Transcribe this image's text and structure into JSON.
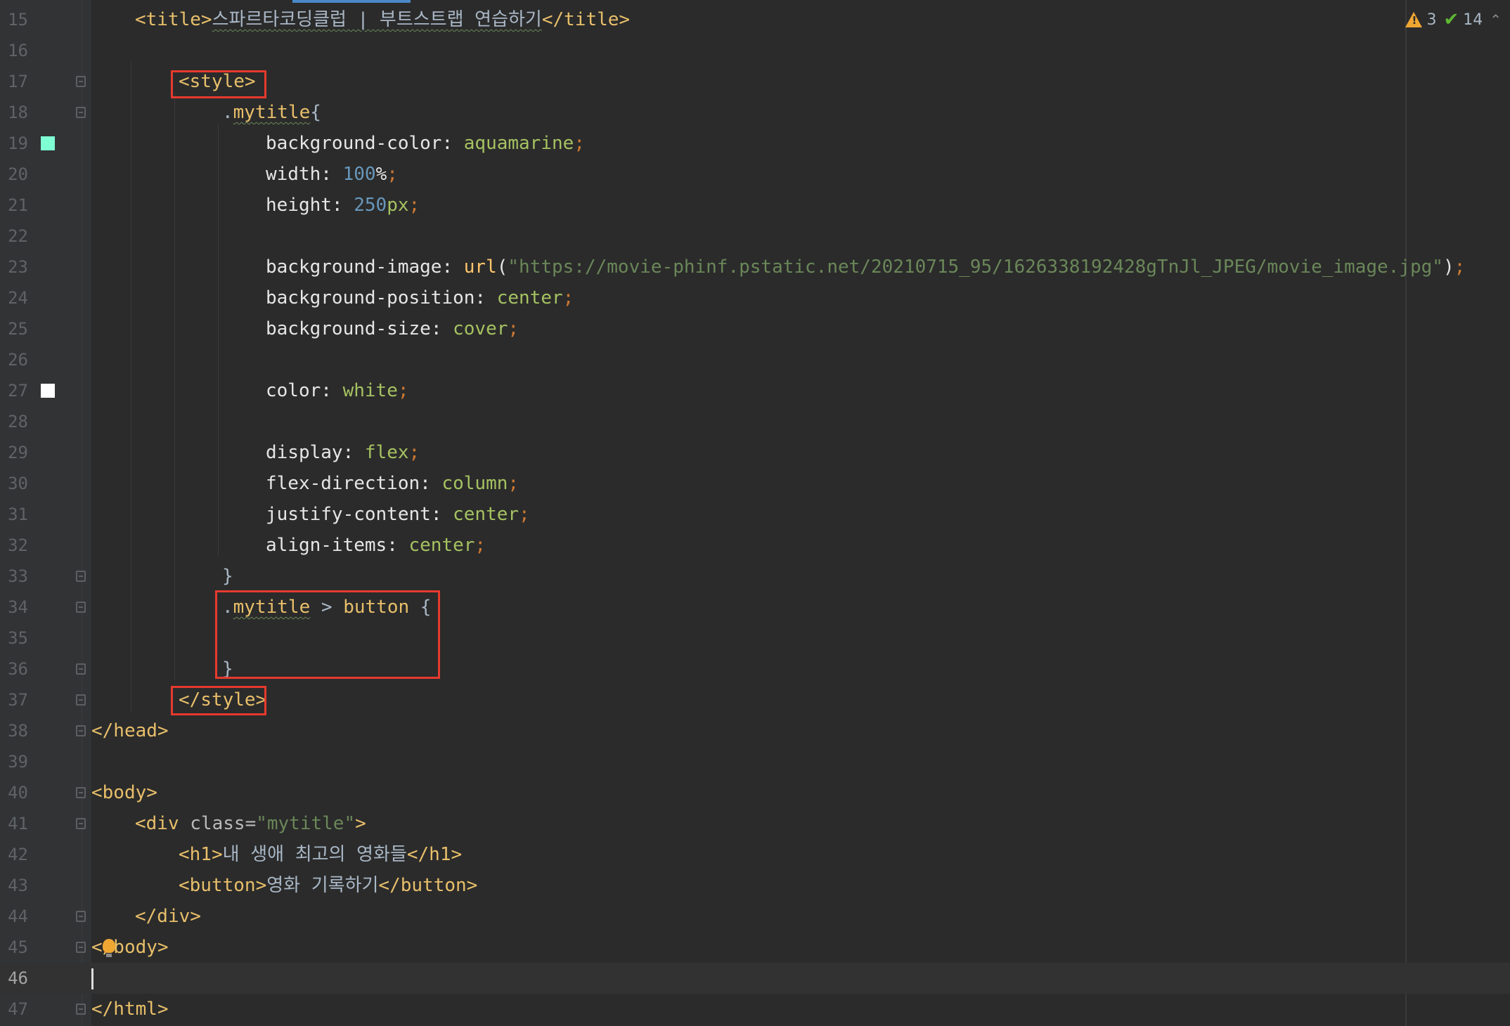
{
  "status": {
    "warnings_count": "3",
    "checks_count": "14"
  },
  "colors": {
    "aquamarine_swatch": "#7fffd4",
    "white_swatch": "#ffffff",
    "highlight_box": "#e63a2e"
  },
  "lines": [
    {
      "n": "15"
    },
    {
      "n": "16"
    },
    {
      "n": "17"
    },
    {
      "n": "18"
    },
    {
      "n": "19"
    },
    {
      "n": "20"
    },
    {
      "n": "21"
    },
    {
      "n": "22"
    },
    {
      "n": "23"
    },
    {
      "n": "24"
    },
    {
      "n": "25"
    },
    {
      "n": "26"
    },
    {
      "n": "27"
    },
    {
      "n": "28"
    },
    {
      "n": "29"
    },
    {
      "n": "30"
    },
    {
      "n": "31"
    },
    {
      "n": "32"
    },
    {
      "n": "33"
    },
    {
      "n": "34"
    },
    {
      "n": "35"
    },
    {
      "n": "36"
    },
    {
      "n": "37"
    },
    {
      "n": "38"
    },
    {
      "n": "39"
    },
    {
      "n": "40"
    },
    {
      "n": "41"
    },
    {
      "n": "42"
    },
    {
      "n": "43"
    },
    {
      "n": "44"
    },
    {
      "n": "45"
    },
    {
      "n": "46"
    },
    {
      "n": "47"
    }
  ],
  "code": {
    "l15": {
      "open": "<title>",
      "text": "스파르타코딩클럽 | 부트스트랩 연습하기",
      "close": "</title>"
    },
    "l17": {
      "tag": "<style>"
    },
    "l18": {
      "dot": ".",
      "selector": "mytitle",
      "brace": "{"
    },
    "l19": {
      "prop": "background-color",
      "colon": ": ",
      "value": "aquamarine",
      "semi": ";"
    },
    "l20": {
      "prop": "width",
      "colon": ": ",
      "num": "100",
      "unit": "%",
      "semi": ";"
    },
    "l21": {
      "prop": "height",
      "colon": ": ",
      "num": "250",
      "unit": "px",
      "semi": ";"
    },
    "l23": {
      "prop": "background-image",
      "colon": ": ",
      "fn": "url",
      "paren_open": "(",
      "str": "\"https://movie-phinf.pstatic.net/20210715_95/1626338192428gTnJl_JPEG/movie_image.jpg\"",
      "paren_close": ")",
      "semi": ";"
    },
    "l24": {
      "prop": "background-position",
      "colon": ": ",
      "value": "center",
      "semi": ";"
    },
    "l25": {
      "prop": "background-size",
      "colon": ": ",
      "value": "cover",
      "semi": ";"
    },
    "l27": {
      "prop": "color",
      "colon": ": ",
      "value": "white",
      "semi": ";"
    },
    "l29": {
      "prop": "display",
      "colon": ": ",
      "value": "flex",
      "semi": ";"
    },
    "l30": {
      "prop": "flex-direction",
      "colon": ": ",
      "value": "column",
      "semi": ";"
    },
    "l31": {
      "prop": "justify-content",
      "colon": ": ",
      "value": "center",
      "semi": ";"
    },
    "l32": {
      "prop": "align-items",
      "colon": ": ",
      "value": "center",
      "semi": ";"
    },
    "l33": {
      "brace": "}"
    },
    "l34": {
      "dot": ".",
      "selector": "mytitle",
      "combinator": " > ",
      "element": "button",
      "brace": " {"
    },
    "l36": {
      "brace": "}"
    },
    "l37": {
      "tag": "</style>"
    },
    "l38": {
      "tag": "</head>"
    },
    "l40": {
      "tag": "<body>"
    },
    "l41": {
      "open": "<div ",
      "attr": "class",
      "eq": "=",
      "str": "\"mytitle\"",
      "close": ">"
    },
    "l42": {
      "open": "<h1>",
      "text": "내 생애 최고의 영화들",
      "close": "</h1>"
    },
    "l43": {
      "open": "<button>",
      "text": "영화 기록하기",
      "close": "</button>"
    },
    "l44": {
      "tag": "</div>"
    },
    "l45": {
      "tag": "</body>"
    },
    "l47": {
      "tag": "</html>"
    }
  }
}
